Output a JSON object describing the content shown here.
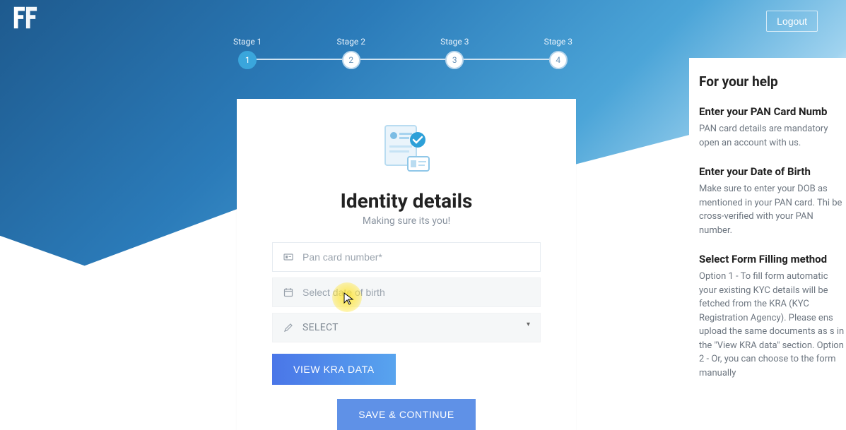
{
  "header": {
    "logout_label": "Logout"
  },
  "stepper": {
    "steps": [
      {
        "label": "Stage 1",
        "num": "1"
      },
      {
        "label": "Stage 2",
        "num": "2"
      },
      {
        "label": "Stage 3",
        "num": "3"
      },
      {
        "label": "Stage 3",
        "num": "4"
      }
    ]
  },
  "card": {
    "title": "Identity details",
    "subtitle": "Making sure its you!",
    "pan_placeholder": "Pan card number*",
    "dob_placeholder": "Select date of birth",
    "select_label": "SELECT",
    "kra_btn": "VIEW KRA DATA",
    "continue_btn": "SAVE & CONTINUE"
  },
  "help": {
    "title": "For your help",
    "sections": [
      {
        "heading": "Enter your PAN Card Numb",
        "body": "PAN card details are mandatory open an account with us."
      },
      {
        "heading": "Enter your Date of Birth",
        "body": "Make sure to enter your DOB as mentioned in your PAN card. Thi be cross-verified with your PAN number."
      },
      {
        "heading": "Select Form Filling method",
        "body": "Option 1 - To fill form automatic your existing KYC details will be fetched from the KRA (KYC Registration Agency). Please ens upload the same documents as s in the \"View KRA data\" section. Option 2 - Or, you can choose to the form manually"
      }
    ]
  }
}
